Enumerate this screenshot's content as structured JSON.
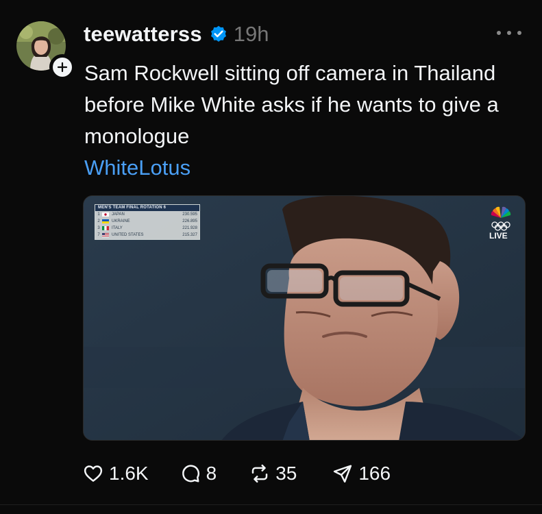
{
  "post": {
    "username": "teewatterss",
    "timestamp": "19h",
    "text": "Sam Rockwell sitting off camera in Thailand before Mike White asks if he wants to give a monologue",
    "tag": "WhiteLotus"
  },
  "media": {
    "scoreboard": {
      "title": "MEN'S TEAM FINAL  ROTATION 6",
      "rows": [
        {
          "rank": "1",
          "country": "JAPAN",
          "score": "230.595"
        },
        {
          "rank": "2",
          "country": "UKRAINE",
          "score": "226.895"
        },
        {
          "rank": "3",
          "country": "ITALY",
          "score": "221.928"
        },
        {
          "rank": "7",
          "country": "UNITED STATES",
          "score": "215.327"
        }
      ]
    },
    "live_label": "LIVE"
  },
  "actions": {
    "likes": "1.6K",
    "replies": "8",
    "reposts": "35",
    "shares": "166"
  },
  "colors": {
    "background": "#0a0a0a",
    "text": "#f3f5f7",
    "muted": "#777777",
    "tag": "#4a9ff5",
    "verified": "#0095f6"
  }
}
